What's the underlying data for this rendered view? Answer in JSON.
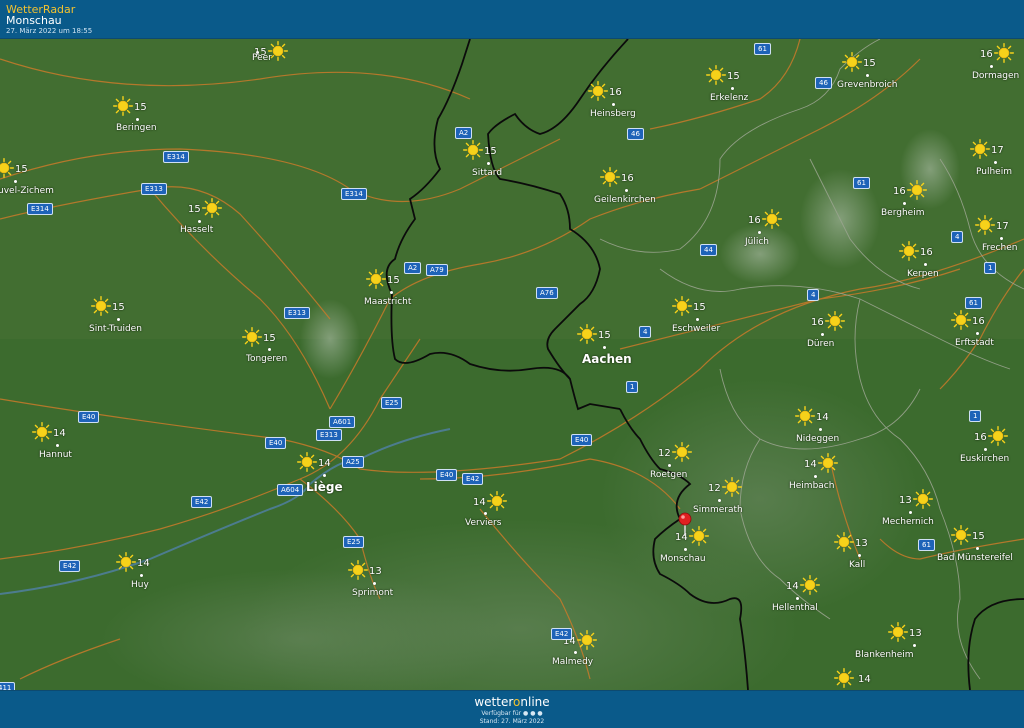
{
  "header": {
    "brand": "WetterRadar",
    "location": "Monschau",
    "timestamp": "27. März 2022 um 18:55"
  },
  "footer": {
    "logo_pre": "wetter",
    "logo_o": "o",
    "logo_post": "nline",
    "available": "Verfügbar für ● ● ●",
    "stand": "Stand: 27. März 2022"
  },
  "colors": {
    "bar": "#0a5a8a",
    "terrain": "#3f6b2f",
    "border": "#000000",
    "road": "#c97a2a",
    "sun": "#f6d21a",
    "pin": "#e02020",
    "river": "#4f7fa0"
  },
  "cities": [
    {
      "name": "Peer",
      "temp": "15"
    },
    {
      "name": "Beringen",
      "temp": "15"
    },
    {
      "name": "Hasselt",
      "temp": "15"
    },
    {
      "name": "Sint-Truiden",
      "temp": "15"
    },
    {
      "name": "Tongeren",
      "temp": "15"
    },
    {
      "name": "Hannut",
      "temp": "14"
    },
    {
      "name": "Huy",
      "temp": "14"
    },
    {
      "name": "Liège",
      "temp": "14"
    },
    {
      "name": "Sprimont",
      "temp": "13"
    },
    {
      "name": "Verviers",
      "temp": "14"
    },
    {
      "name": "Malmedy",
      "temp": "14"
    },
    {
      "name": "Maastricht",
      "temp": "15"
    },
    {
      "name": "Sittard",
      "temp": "15"
    },
    {
      "name": "Heinsberg",
      "temp": "16"
    },
    {
      "name": "Geilenkirchen",
      "temp": "16"
    },
    {
      "name": "Aachen",
      "temp": "15"
    },
    {
      "name": "Eschweiler",
      "temp": "15"
    },
    {
      "name": "Roetgen",
      "temp": "12"
    },
    {
      "name": "Simmerath",
      "temp": "12"
    },
    {
      "name": "Monschau",
      "temp": "14"
    },
    {
      "name": "Erkelenz",
      "temp": "15"
    },
    {
      "name": "Jülich",
      "temp": "16"
    },
    {
      "name": "Düren",
      "temp": "16"
    },
    {
      "name": "Nideggen",
      "temp": "14"
    },
    {
      "name": "Heimbach",
      "temp": "14"
    },
    {
      "name": "Hellenthal",
      "temp": "14"
    },
    {
      "name": "Mechernich",
      "temp": "13"
    },
    {
      "name": "Kall",
      "temp": "13"
    },
    {
      "name": "Blankenheim",
      "temp": "13"
    },
    {
      "name": "Grevenbroich",
      "temp": "15"
    },
    {
      "name": "Bergheim",
      "temp": "16"
    },
    {
      "name": "Kerpen",
      "temp": "16"
    },
    {
      "name": "Erftstadt",
      "temp": "16"
    },
    {
      "name": "Euskirchen",
      "temp": "16"
    },
    {
      "name": "Bad Münstereifel",
      "temp": "15"
    },
    {
      "name": "Dormagen",
      "temp": "16"
    },
    {
      "name": "Pulheim",
      "temp": "17"
    },
    {
      "name": "Frechen",
      "temp": "17"
    },
    {
      "name": "uvel-Zichem",
      "temp": "15"
    }
  ],
  "extra_suns": [
    {
      "temp": "14"
    }
  ],
  "roads": [
    "E314",
    "E313",
    "E314",
    "E314",
    "E313",
    "A2",
    "A2",
    "A79",
    "A76",
    "4",
    "44",
    "46",
    "61",
    "61",
    "46",
    "61",
    "4",
    "4",
    "1",
    "1",
    "61",
    "E40",
    "E40",
    "E40",
    "E42",
    "E42",
    "A25",
    "A601",
    "E313",
    "A604",
    "E25",
    "E25",
    "E42",
    "E40",
    "E42",
    "1",
    "411"
  ]
}
